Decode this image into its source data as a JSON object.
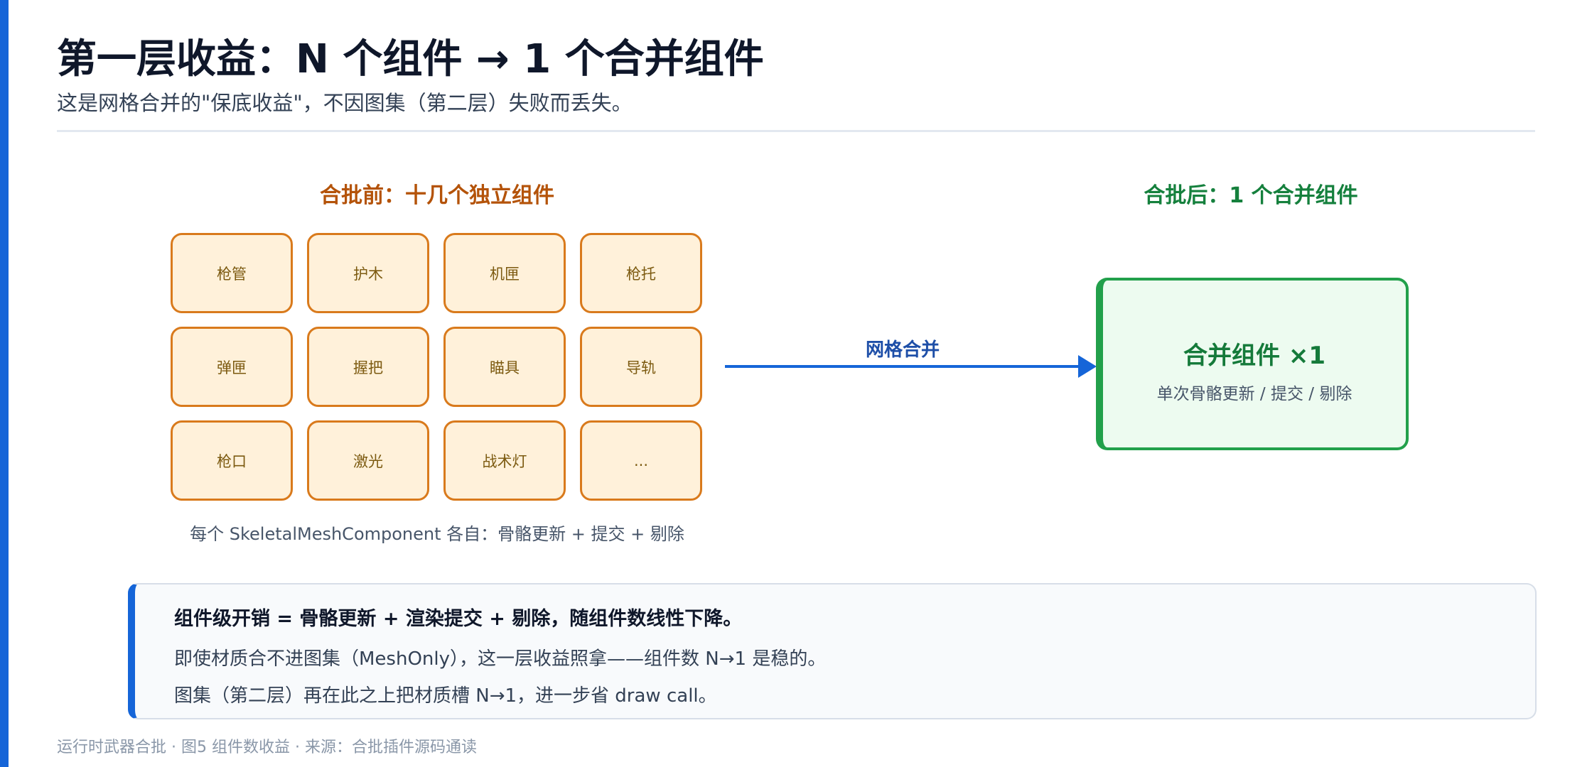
{
  "header": {
    "title": "第一层收益：N 个组件 → 1 个合并组件",
    "subtitle": "这是网格合并的\"保底收益\"，不因图集（第二层）失败而丢失。"
  },
  "before": {
    "heading": "合批前：十几个独立组件",
    "components": [
      "枪管",
      "护木",
      "机匣",
      "枪托",
      "弹匣",
      "握把",
      "瞄具",
      "导轨",
      "枪口",
      "激光",
      "战术灯",
      "..."
    ],
    "caption": "每个 SkeletalMeshComponent 各自：骨骼更新 + 提交 + 剔除"
  },
  "arrow": {
    "label": "网格合并"
  },
  "after": {
    "heading": "合批后：1 个合并组件",
    "box_title": "合并组件 ×1",
    "box_subtitle": "单次骨骼更新 / 提交 / 剔除"
  },
  "note": {
    "line1": "组件级开销 = 骨骼更新 + 渲染提交 + 剔除，随组件数线性下降。",
    "line2": "即使材质合不进图集（MeshOnly），这一层收益照拿——组件数 N→1 是稳的。",
    "line3": "图集（第二层）再在此之上把材质槽 N→1，进一步省 draw call。"
  },
  "footer": {
    "text": "运行时武器合批 · 图5 组件数收益 · 来源：合批插件源码通读"
  },
  "colors": {
    "accent_blue": "#1565d8",
    "before_orange": "#b45309",
    "component_fill": "#fff1da",
    "component_border": "#d97a1c",
    "after_green": "#15803d",
    "merged_fill": "#edfbf0"
  }
}
